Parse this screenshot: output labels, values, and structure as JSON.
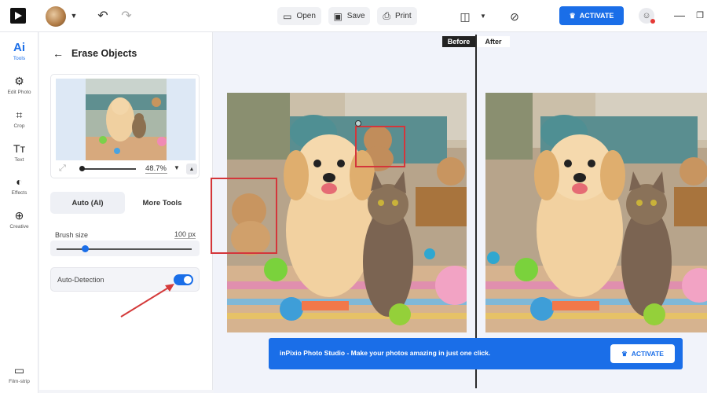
{
  "topbar": {
    "open_label": "Open",
    "save_label": "Save",
    "print_label": "Print",
    "activate_label": "ACTIVATE",
    "accent": "#1a6ee8"
  },
  "rail": {
    "items": [
      {
        "icon": "ai-icon",
        "glyph": "Ai",
        "label": "Tools"
      },
      {
        "icon": "edit-photo-icon",
        "glyph": "⚙",
        "label": "Edit Photo"
      },
      {
        "icon": "crop-icon",
        "glyph": "⌗",
        "label": "Crop"
      },
      {
        "icon": "text-icon",
        "glyph": "Tт",
        "label": "Text"
      },
      {
        "icon": "effects-icon",
        "glyph": "◐",
        "label": "Effects"
      },
      {
        "icon": "creative-icon",
        "glyph": "⊕",
        "label": "Creative"
      }
    ],
    "filmstrip": {
      "glyph": "▭",
      "label": "Film-strip"
    }
  },
  "panel": {
    "title": "Erase Objects",
    "zoom_value": "48.7%",
    "tabs": [
      {
        "label": "Auto (AI)",
        "active": true
      },
      {
        "label": "More Tools",
        "active": false
      }
    ],
    "brush_label": "Brush size",
    "brush_value": "100 px",
    "auto_detection_label": "Auto-Detection",
    "auto_detection_on": true
  },
  "canvas": {
    "before_label": "Before",
    "after_label": "After"
  },
  "banner": {
    "text": "inPixio Photo Studio - Make your photos amazing in just one click.",
    "button_label": "ACTIVATE"
  }
}
